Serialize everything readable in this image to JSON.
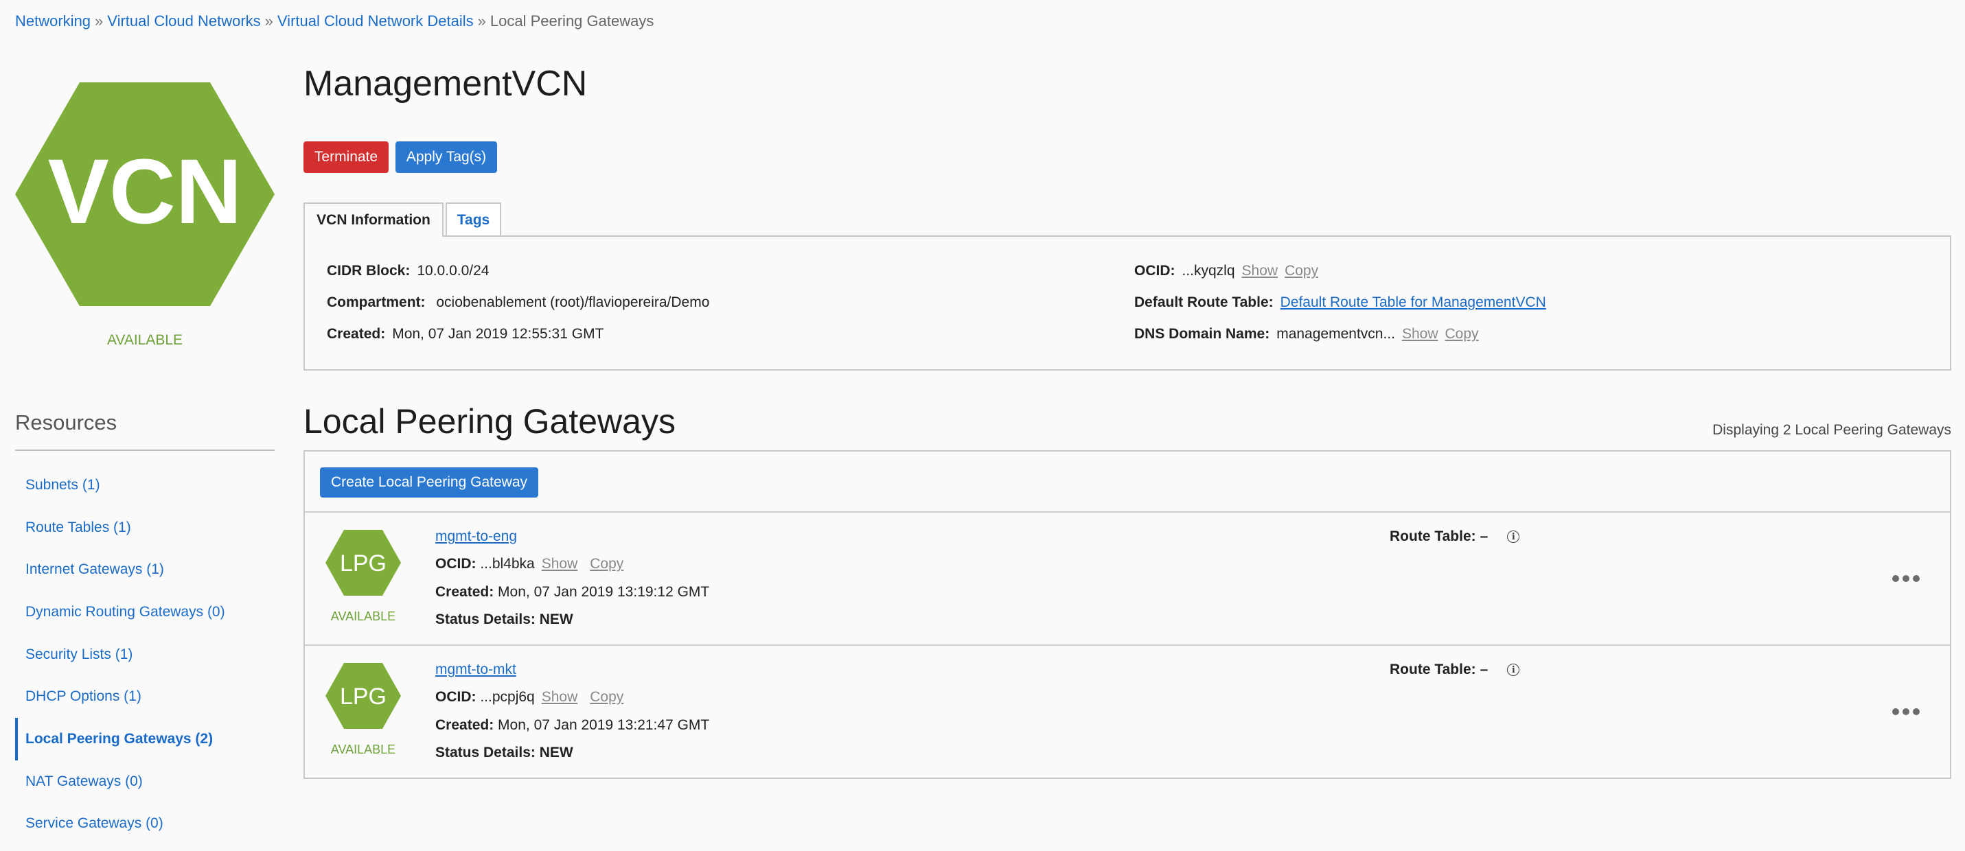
{
  "breadcrumb": {
    "items": [
      "Networking",
      "Virtual Cloud Networks",
      "Virtual Cloud Network Details"
    ],
    "current": "Local Peering Gateways",
    "separator": "»"
  },
  "vcn": {
    "icon_label": "VCN",
    "status": "AVAILABLE",
    "name": "ManagementVCN"
  },
  "actions": {
    "terminate": "Terminate",
    "apply_tags": "Apply Tag(s)"
  },
  "tabs": {
    "info": "VCN Information",
    "tags": "Tags"
  },
  "info": {
    "cidr_label": "CIDR Block:",
    "cidr_value": "10.0.0.0/24",
    "compartment_label": "Compartment:",
    "compartment_value": "ociobenablement (root)/flaviopereira/Demo",
    "created_label": "Created:",
    "created_value": "Mon, 07 Jan 2019 12:55:31 GMT",
    "ocid_label": "OCID:",
    "ocid_value": "...kyqzlq",
    "show": "Show",
    "copy": "Copy",
    "route_table_label": "Default Route Table:",
    "route_table_value": "Default Route Table for ManagementVCN",
    "dns_label": "DNS Domain Name:",
    "dns_value": "managementvcn..."
  },
  "resources": {
    "title": "Resources",
    "items": [
      "Subnets (1)",
      "Route Tables (1)",
      "Internet Gateways (1)",
      "Dynamic Routing Gateways (0)",
      "Security Lists (1)",
      "DHCP Options (1)",
      "Local Peering Gateways (2)",
      "NAT Gateways (0)",
      "Service Gateways (0)"
    ]
  },
  "lpg": {
    "section_title": "Local Peering Gateways",
    "display_count": "Displaying 2 Local Peering Gateways",
    "create_button": "Create Local Peering Gateway",
    "icon_label": "LPG",
    "ocid_label": "OCID:",
    "created_label": "Created:",
    "status_details_label": "Status Details:",
    "route_table_label": "Route Table:",
    "show": "Show",
    "copy": "Copy",
    "items": [
      {
        "name": "mgmt-to-eng",
        "status": "AVAILABLE",
        "ocid": "...bl4bka",
        "created": "Mon, 07 Jan 2019 13:19:12 GMT",
        "status_details": "NEW",
        "route_table": "–"
      },
      {
        "name": "mgmt-to-mkt",
        "status": "AVAILABLE",
        "ocid": "...pcpj6q",
        "created": "Mon, 07 Jan 2019 13:21:47 GMT",
        "status_details": "NEW",
        "route_table": "–"
      }
    ]
  },
  "colors": {
    "hex_green": "#7fad39",
    "link_blue": "#1a6bc7",
    "danger_red": "#d32f2f",
    "primary_blue": "#2b78d0"
  }
}
